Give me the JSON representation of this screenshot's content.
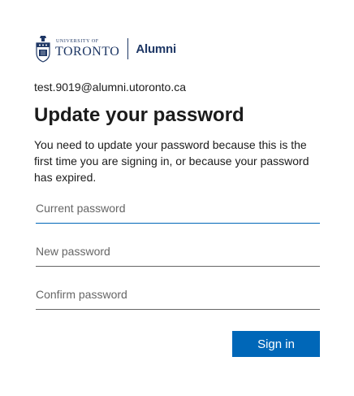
{
  "logo": {
    "university_small": "UNIVERSITY OF",
    "university_big": "TORONTO",
    "division": "Alumni"
  },
  "identity": {
    "email": "test.9019@alumni.utoronto.ca"
  },
  "form": {
    "title": "Update your password",
    "description": "You need to update your password because this is the first time you are signing in, or because your password has expired.",
    "current_password": {
      "placeholder": "Current password",
      "value": ""
    },
    "new_password": {
      "placeholder": "New password",
      "value": ""
    },
    "confirm_password": {
      "placeholder": "Confirm password",
      "value": ""
    },
    "submit_label": "Sign in"
  },
  "colors": {
    "brand_navy": "#1e3765",
    "primary_button": "#0067b8",
    "focus_underline": "#0067b8",
    "text": "#1b1b1b",
    "placeholder": "#666666"
  }
}
